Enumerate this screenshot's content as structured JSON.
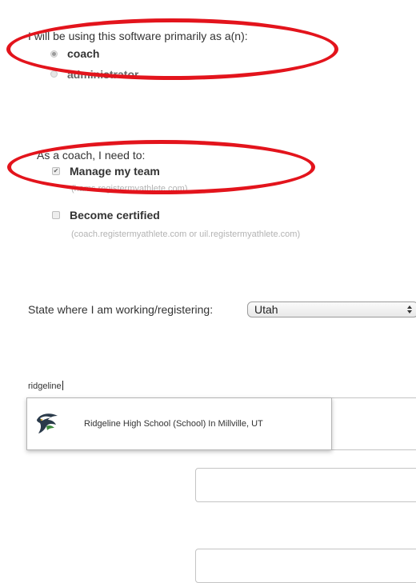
{
  "role_question": {
    "text": "I will be using this software primarily as a(n):",
    "options": [
      {
        "label": "coach",
        "selected": true
      },
      {
        "label": "administrator",
        "selected": false
      }
    ]
  },
  "needs_question": {
    "text": "As a coach, I need to:",
    "options": [
      {
        "label": "Manage my team",
        "checked": true,
        "hint": "(hams.registermyathlete.com)"
      },
      {
        "label": "Become certified",
        "checked": false,
        "hint": "(coach.registermyathlete.com or uil.registermyathlete.com)"
      }
    ]
  },
  "state": {
    "label": "State where I am working/registering:",
    "selected": "Utah"
  },
  "school_search": {
    "value": "ridgeline",
    "results": [
      {
        "label": "Ridgeline High School (School) In Millville, UT",
        "icon": "hawk-mascot-logo"
      }
    ]
  },
  "annotation": {
    "color": "#e3141c"
  }
}
